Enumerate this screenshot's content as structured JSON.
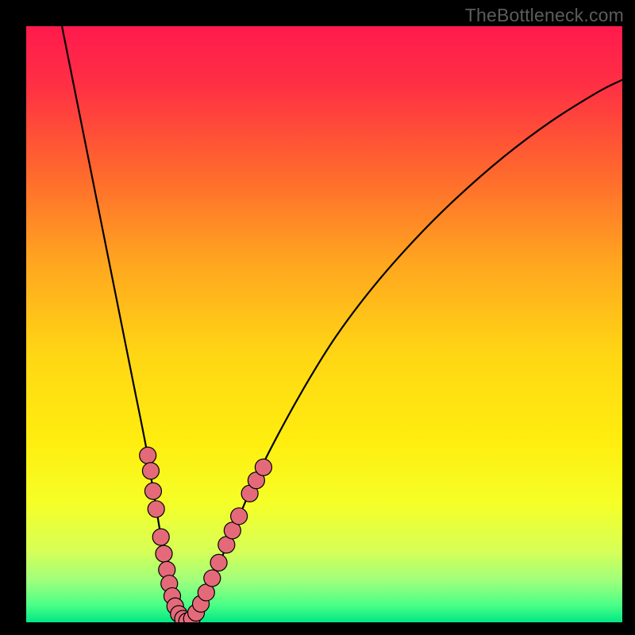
{
  "watermark": "TheBottleneck.com",
  "chart_data": {
    "type": "line",
    "title": "",
    "xlabel": "",
    "ylabel": "",
    "xlim": [
      0,
      100
    ],
    "ylim": [
      0,
      100
    ],
    "gradient_stops": [
      {
        "offset": 0,
        "color": "#ff1a4d"
      },
      {
        "offset": 0.1,
        "color": "#ff3044"
      },
      {
        "offset": 0.25,
        "color": "#ff6a2d"
      },
      {
        "offset": 0.4,
        "color": "#ffa71f"
      },
      {
        "offset": 0.55,
        "color": "#ffd614"
      },
      {
        "offset": 0.7,
        "color": "#ffee0f"
      },
      {
        "offset": 0.8,
        "color": "#f5ff28"
      },
      {
        "offset": 0.88,
        "color": "#d7ff56"
      },
      {
        "offset": 0.93,
        "color": "#9fff7c"
      },
      {
        "offset": 0.97,
        "color": "#4dff86"
      },
      {
        "offset": 1.0,
        "color": "#00e884"
      }
    ],
    "series": [
      {
        "name": "bottleneck-curve",
        "x": [
          6,
          8,
          10,
          12,
          14,
          16,
          18,
          20,
          21,
          22,
          23,
          24,
          25,
          26,
          27,
          28,
          30,
          32,
          35,
          38,
          42,
          47,
          52,
          58,
          65,
          72,
          80,
          88,
          96,
          100
        ],
        "y": [
          100,
          90,
          80,
          70,
          60,
          50,
          40,
          30,
          24,
          18,
          12,
          7,
          3,
          1,
          0,
          1,
          4,
          9,
          16,
          23,
          31,
          40,
          48,
          56,
          64,
          71,
          78,
          84,
          89,
          91
        ]
      }
    ],
    "markers": {
      "name": "highlight-beads",
      "color": "#e46a7a",
      "outline": "#000000",
      "points": [
        {
          "x": 20.4,
          "y": 28.0
        },
        {
          "x": 20.9,
          "y": 25.4
        },
        {
          "x": 21.3,
          "y": 22.0
        },
        {
          "x": 21.8,
          "y": 19.0
        },
        {
          "x": 22.6,
          "y": 14.3
        },
        {
          "x": 23.1,
          "y": 11.5
        },
        {
          "x": 23.6,
          "y": 8.8
        },
        {
          "x": 24.0,
          "y": 6.5
        },
        {
          "x": 24.5,
          "y": 4.4
        },
        {
          "x": 25.0,
          "y": 2.7
        },
        {
          "x": 25.6,
          "y": 1.4
        },
        {
          "x": 26.3,
          "y": 0.6
        },
        {
          "x": 27.0,
          "y": 0.2
        },
        {
          "x": 27.8,
          "y": 0.6
        },
        {
          "x": 28.5,
          "y": 1.6
        },
        {
          "x": 29.3,
          "y": 3.1
        },
        {
          "x": 30.2,
          "y": 5.0
        },
        {
          "x": 31.2,
          "y": 7.4
        },
        {
          "x": 32.3,
          "y": 10.0
        },
        {
          "x": 33.6,
          "y": 13.0
        },
        {
          "x": 34.6,
          "y": 15.4
        },
        {
          "x": 35.7,
          "y": 17.8
        },
        {
          "x": 37.5,
          "y": 21.6
        },
        {
          "x": 38.6,
          "y": 23.8
        },
        {
          "x": 39.8,
          "y": 26.0
        }
      ]
    }
  }
}
